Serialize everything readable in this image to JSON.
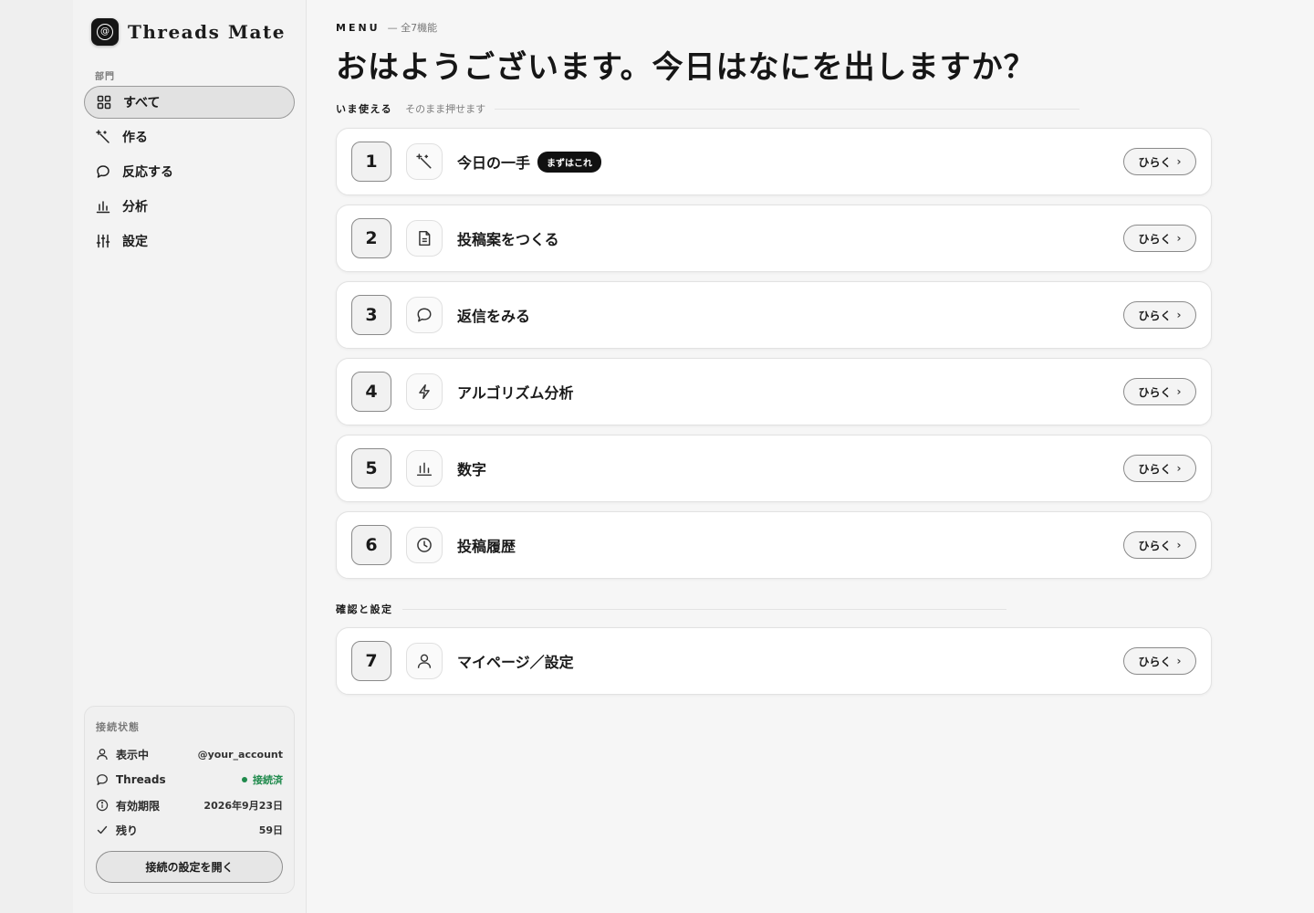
{
  "brand": {
    "name": "Threads Mate",
    "logo_glyph": "@"
  },
  "sidebar": {
    "section_label": "部門",
    "items": [
      {
        "label": "すべて",
        "icon": "grid-icon",
        "active": true
      },
      {
        "label": "作る",
        "icon": "sparkle-icon"
      },
      {
        "label": "反応する",
        "icon": "chat-bubble-icon"
      },
      {
        "label": "分析",
        "icon": "bar-chart-icon"
      },
      {
        "label": "設定",
        "icon": "sliders-icon"
      }
    ]
  },
  "status": {
    "title": "接続状態",
    "rows": [
      {
        "label": "表示中",
        "value": "@your_account",
        "icon": "user-icon"
      },
      {
        "label": "Threads",
        "value": "接続済",
        "icon": "chat-bubble-icon",
        "status_color": "#1f8a4c"
      },
      {
        "label": "有効期限",
        "value": "2026年9月23日",
        "icon": "info-icon"
      },
      {
        "label": "残り",
        "value": "59日",
        "icon": "check-icon"
      }
    ],
    "button_label": "接続の設定を開く"
  },
  "main": {
    "eyebrow": "MENU",
    "eyebrow_sub": "— 全7機能",
    "headline": "おはようございます。今日はなにを出しますか？",
    "group1": {
      "title": "いま使える",
      "subtitle": "そのまま押せます"
    },
    "group2": {
      "title": "確認と設定"
    },
    "open_label": "ひらく",
    "cards": [
      {
        "num": "1",
        "title": "今日の一手",
        "badge": "まずはこれ",
        "icon": "sparkle-icon"
      },
      {
        "num": "2",
        "title": "投稿案をつくる",
        "icon": "document-icon"
      },
      {
        "num": "3",
        "title": "返信をみる",
        "icon": "chat-bubble-icon"
      },
      {
        "num": "4",
        "title": "アルゴリズム分析",
        "icon": "lightning-icon"
      },
      {
        "num": "5",
        "title": "数字",
        "icon": "bar-chart-icon"
      },
      {
        "num": "6",
        "title": "投稿履歴",
        "icon": "clock-icon"
      },
      {
        "num": "7",
        "title": "マイページ／設定",
        "icon": "user-icon"
      }
    ]
  }
}
